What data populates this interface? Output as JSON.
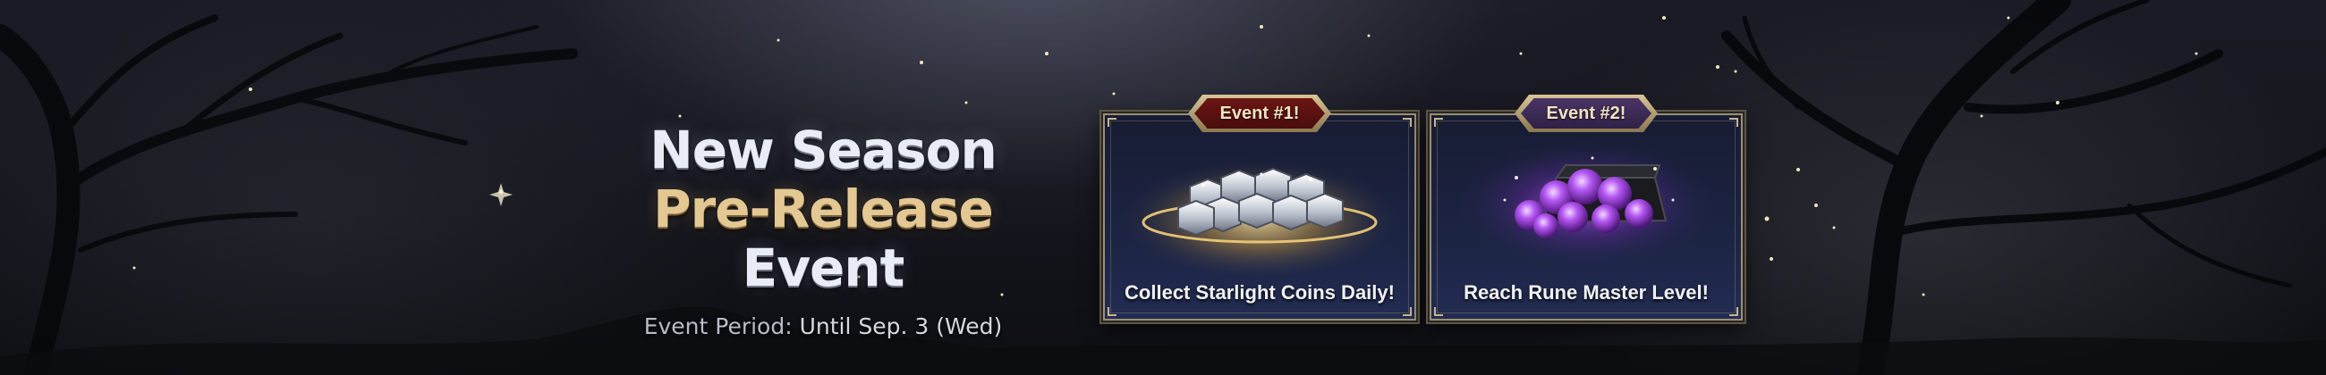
{
  "banner": {
    "title_line1": "New Season",
    "title_line2_gold": "Pre-Release",
    "title_line2_silver": "Event",
    "period_label": "Event Period:",
    "period_value": "Until Sep. 3 (Wed)"
  },
  "events": [
    {
      "tag": "Event #1!",
      "caption": "Collect Starlight Coins Daily!",
      "tag_color": "#5a1110",
      "art": "silver-coins-icon"
    },
    {
      "tag": "Event #2!",
      "caption": "Reach Rune Master Level!",
      "tag_color": "#3b2a55",
      "art": "purple-rune-chest-icon"
    }
  ],
  "colors": {
    "gold": "#e3c894",
    "silver": "#e9ecf4",
    "card_border": "#9a8f76",
    "card_bg": "#1c2443"
  }
}
